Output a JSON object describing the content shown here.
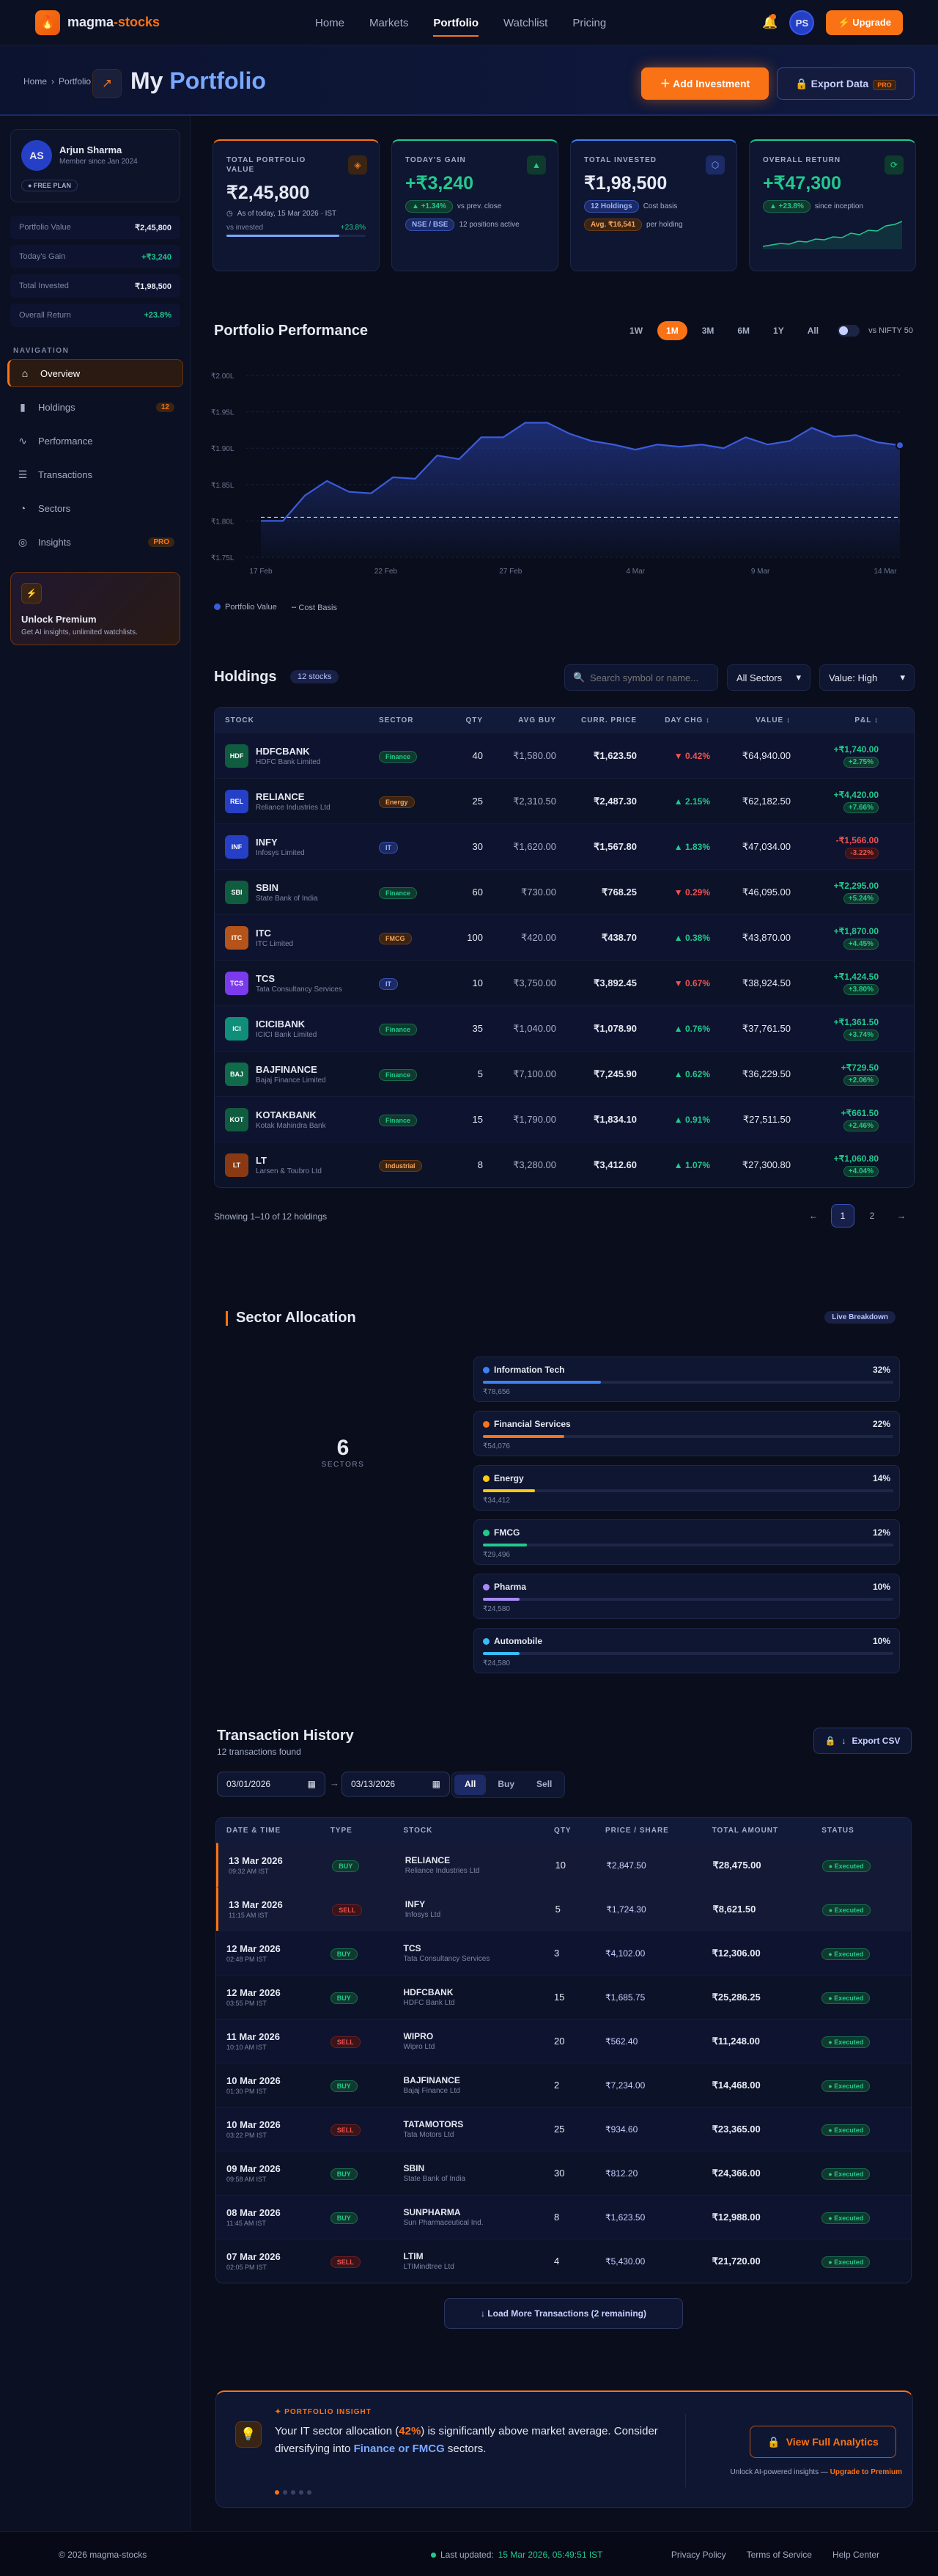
{
  "brand": {
    "name_a": "magma",
    "name_sep": "-",
    "name_b": "stocks"
  },
  "nav": {
    "links": [
      "Home",
      "Markets",
      "Portfolio",
      "Watchlist",
      "Pricing"
    ],
    "active": 2,
    "avatar": "PS",
    "upgrade": "Upgrade"
  },
  "header": {
    "crumb_home": "Home",
    "crumb_sep": "›",
    "crumb_current": "Portfolio",
    "title_a": "My",
    "title_b": "Portfolio",
    "add": "Add Investment",
    "export": "Export Data",
    "export_badge": "PRO"
  },
  "profile": {
    "initials": "AS",
    "name": "Arjun Sharma",
    "since": "Member since Jan 2024",
    "plan": "● FREE PLAN"
  },
  "side_stats": [
    {
      "label": "Portfolio Value",
      "value": "₹2,45,800",
      "tone": ""
    },
    {
      "label": "Today's Gain",
      "value": "+₹3,240",
      "tone": "green"
    },
    {
      "label": "Total Invested",
      "value": "₹1,98,500",
      "tone": ""
    },
    {
      "label": "Overall Return",
      "value": "+23.8%",
      "tone": "green"
    }
  ],
  "nav_label": "NAVIGATION",
  "side_nav": [
    {
      "label": "Overview",
      "icon": "home-icon",
      "badge": ""
    },
    {
      "label": "Holdings",
      "icon": "bar-chart-icon",
      "badge": "12"
    },
    {
      "label": "Performance",
      "icon": "pulse-icon",
      "badge": ""
    },
    {
      "label": "Transactions",
      "icon": "list-icon",
      "badge": ""
    },
    {
      "label": "Sectors",
      "icon": "pie-icon",
      "badge": ""
    },
    {
      "label": "Insights",
      "icon": "bulb-icon",
      "badge": "PRO"
    }
  ],
  "promo": {
    "title": "Unlock Premium",
    "desc": "Get AI insights, unlimited watchlists."
  },
  "kpis": [
    {
      "label": "TOTAL PORTFOLIO VALUE",
      "value": "₹2,45,800",
      "note": "As of today, 15 Mar 2026 · IST",
      "bar_label": "vs invested",
      "bar_value": "+23.8%",
      "bar_fill": 0.81,
      "accent": "#f97316"
    },
    {
      "label": "TODAY'S GAIN",
      "value": "+₹3,240",
      "pill": "▲ +1.34%",
      "note": "vs prev. close",
      "pill2": "NSE / BSE",
      "note2": "12 positions active",
      "accent": "#22c98e"
    },
    {
      "label": "TOTAL INVESTED",
      "value": "₹1,98,500",
      "pill": "12 Holdings",
      "note": "Cost basis",
      "pill2": "Avg. ₹16,541",
      "note2": "per holding",
      "accent": "#3b82f6"
    },
    {
      "label": "OVERALL RETURN",
      "value": "+₹47,300",
      "pill": "▲ +23.8%",
      "note": "since inception",
      "accent": "#22c98e"
    }
  ],
  "perf": {
    "title": "Portfolio Performance",
    "ranges": [
      "1W",
      "1M",
      "3M",
      "6M",
      "1Y",
      "All"
    ],
    "active_range": 1,
    "compare": "vs NIFTY 50",
    "legend_value": "Portfolio Value",
    "legend_cost": "Cost Basis"
  },
  "chart_data": {
    "type": "line",
    "y_ticks": [
      "₹2.00L",
      "₹1.95L",
      "₹1.90L",
      "₹1.85L",
      "₹1.80L",
      "₹1.75L"
    ],
    "x_ticks": [
      "17 Feb",
      "22 Feb",
      "27 Feb",
      "4 Mar",
      "9 Mar",
      "14 Mar"
    ],
    "ylim": [
      1.75,
      2.0
    ],
    "series": [
      {
        "name": "Portfolio Value",
        "values": [
          1.8,
          1.8,
          1.835,
          1.855,
          1.84,
          1.838,
          1.86,
          1.858,
          1.89,
          1.885,
          1.915,
          1.915,
          1.935,
          1.935,
          1.92,
          1.91,
          1.905,
          1.898,
          1.905,
          1.902,
          1.905,
          1.9,
          1.915,
          1.905,
          1.91,
          1.928,
          1.916,
          1.918,
          1.908,
          1.904
        ]
      },
      {
        "name": "Cost Basis",
        "values": [
          1.805,
          1.805,
          1.805,
          1.805,
          1.805,
          1.805,
          1.805,
          1.805,
          1.805,
          1.805,
          1.805,
          1.805,
          1.805,
          1.805,
          1.805,
          1.805,
          1.805,
          1.805,
          1.805,
          1.805,
          1.805,
          1.805,
          1.805,
          1.805,
          1.805,
          1.805,
          1.805,
          1.805,
          1.805,
          1.805
        ]
      }
    ],
    "grid": true,
    "legend": "bottom-left"
  },
  "holdings": {
    "title": "Holdings",
    "count": "12 stocks",
    "search_placeholder": "Search symbol or name...",
    "sector_filter": "All Sectors",
    "sort": "Value: High",
    "columns": [
      "STOCK",
      "SECTOR",
      "QTY",
      "AVG BUY",
      "CURR. PRICE",
      "DAY CHG ↕",
      "VALUE ↕",
      "P&L ↕"
    ],
    "rows": [
      {
        "tk": "HDF",
        "sym": "HDFCBANK",
        "name": "HDFC Bank Limited",
        "sector": "Finance",
        "qty": "40",
        "avg": "₹1,580.00",
        "cur": "₹1,623.50",
        "day": "▼ 0.42%",
        "day_up": false,
        "value": "₹64,940.00",
        "pl": "+₹1,740.00",
        "plp": "+2.75%",
        "pl_up": true,
        "color": "#0f5c3f"
      },
      {
        "tk": "REL",
        "sym": "RELIANCE",
        "name": "Reliance Industries Ltd",
        "sector": "Energy",
        "qty": "25",
        "avg": "₹2,310.50",
        "cur": "₹2,487.30",
        "day": "▲ 2.15%",
        "day_up": true,
        "value": "₹62,182.50",
        "pl": "+₹4,420.00",
        "plp": "+7.66%",
        "pl_up": true,
        "color": "#2540c7"
      },
      {
        "tk": "INF",
        "sym": "INFY",
        "name": "Infosys Limited",
        "sector": "IT",
        "qty": "30",
        "avg": "₹1,620.00",
        "cur": "₹1,567.80",
        "day": "▲ 1.83%",
        "day_up": true,
        "value": "₹47,034.00",
        "pl": "-₹1,566.00",
        "plp": "-3.22%",
        "pl_up": false,
        "color": "#2540c7"
      },
      {
        "tk": "SBI",
        "sym": "SBIN",
        "name": "State Bank of India",
        "sector": "Finance",
        "qty": "60",
        "avg": "₹730.00",
        "cur": "₹768.25",
        "day": "▼ 0.29%",
        "day_up": false,
        "value": "₹46,095.00",
        "pl": "+₹2,295.00",
        "plp": "+5.24%",
        "pl_up": true,
        "color": "#0f5c3f"
      },
      {
        "tk": "ITC",
        "sym": "ITC",
        "name": "ITC Limited",
        "sector": "FMCG",
        "qty": "100",
        "avg": "₹420.00",
        "cur": "₹438.70",
        "day": "▲ 0.38%",
        "day_up": true,
        "value": "₹43,870.00",
        "pl": "+₹1,870.00",
        "plp": "+4.45%",
        "pl_up": true,
        "color": "#b4531a"
      },
      {
        "tk": "TCS",
        "sym": "TCS",
        "name": "Tata Consultancy Services",
        "sector": "IT",
        "qty": "10",
        "avg": "₹3,750.00",
        "cur": "₹3,892.45",
        "day": "▼ 0.67%",
        "day_up": false,
        "value": "₹38,924.50",
        "pl": "+₹1,424.50",
        "plp": "+3.80%",
        "pl_up": true,
        "color": "#7c3aed"
      },
      {
        "tk": "ICI",
        "sym": "ICICIBANK",
        "name": "ICICI Bank Limited",
        "sector": "Finance",
        "qty": "35",
        "avg": "₹1,040.00",
        "cur": "₹1,078.90",
        "day": "▲ 0.76%",
        "day_up": true,
        "value": "₹37,761.50",
        "pl": "+₹1,361.50",
        "plp": "+3.74%",
        "pl_up": true,
        "color": "#0f8f7a"
      },
      {
        "tk": "BAJ",
        "sym": "BAJFINANCE",
        "name": "Bajaj Finance Limited",
        "sector": "Finance",
        "qty": "5",
        "avg": "₹7,100.00",
        "cur": "₹7,245.90",
        "day": "▲ 0.62%",
        "day_up": true,
        "value": "₹36,229.50",
        "pl": "+₹729.50",
        "plp": "+2.06%",
        "pl_up": true,
        "color": "#0f6b4a"
      },
      {
        "tk": "KOT",
        "sym": "KOTAKBANK",
        "name": "Kotak Mahindra Bank",
        "sector": "Finance",
        "qty": "15",
        "avg": "₹1,790.00",
        "cur": "₹1,834.10",
        "day": "▲ 0.91%",
        "day_up": true,
        "value": "₹27,511.50",
        "pl": "+₹661.50",
        "plp": "+2.46%",
        "pl_up": true,
        "color": "#0f5c3f"
      },
      {
        "tk": "LT",
        "sym": "LT",
        "name": "Larsen & Toubro Ltd",
        "sector": "Industrial",
        "qty": "8",
        "avg": "₹3,280.00",
        "cur": "₹3,412.60",
        "day": "▲ 1.07%",
        "day_up": true,
        "value": "₹27,300.80",
        "pl": "+₹1,060.80",
        "plp": "+4.04%",
        "pl_up": true,
        "color": "#8a3a12"
      }
    ],
    "showing": "Showing 1–10 of 12 holdings",
    "pages": [
      "←",
      "1",
      "2",
      "→"
    ]
  },
  "sectors": {
    "title": "Sector Allocation",
    "live": "Live Breakdown",
    "center_value": "6",
    "center_label": "SECTORS",
    "items": [
      {
        "name": "Information Tech",
        "pct": "32%",
        "frac": 0.32,
        "amt": "₹78,656",
        "color": "#3b82f6"
      },
      {
        "name": "Financial Services",
        "pct": "22%",
        "frac": 0.22,
        "amt": "₹54,076",
        "color": "#f97316"
      },
      {
        "name": "Energy",
        "pct": "14%",
        "frac": 0.14,
        "amt": "₹34,412",
        "color": "#facc15"
      },
      {
        "name": "FMCG",
        "pct": "12%",
        "frac": 0.12,
        "amt": "₹29,496",
        "color": "#22c98e"
      },
      {
        "name": "Pharma",
        "pct": "10%",
        "frac": 0.1,
        "amt": "₹24,580",
        "color": "#a78bfa"
      },
      {
        "name": "Automobile",
        "pct": "10%",
        "frac": 0.1,
        "amt": "₹24,580",
        "color": "#38bdf8"
      }
    ]
  },
  "tx": {
    "title": "Transaction History",
    "subtitle": "12 transactions found",
    "export": "Export CSV",
    "from": "03/01/2026",
    "to": "03/13/2026",
    "arrow": "→",
    "filters": [
      "All",
      "Buy",
      "Sell"
    ],
    "columns": [
      "DATE & TIME",
      "TYPE",
      "STOCK",
      "QTY",
      "PRICE / SHARE",
      "TOTAL AMOUNT",
      "STATUS"
    ],
    "rows": [
      {
        "date": "13 Mar 2026",
        "time": "09:32 AM IST",
        "type": "BUY",
        "sym": "RELIANCE",
        "name": "Reliance Industries Ltd",
        "qty": "10",
        "price": "₹2,847.50",
        "total": "₹28,475.00",
        "status": "● Executed",
        "hl": true
      },
      {
        "date": "13 Mar 2026",
        "time": "11:15 AM IST",
        "type": "SELL",
        "sym": "INFY",
        "name": "Infosys Ltd",
        "qty": "5",
        "price": "₹1,724.30",
        "total": "₹8,621.50",
        "status": "● Executed",
        "hl": true
      },
      {
        "date": "12 Mar 2026",
        "time": "02:48 PM IST",
        "type": "BUY",
        "sym": "TCS",
        "name": "Tata Consultancy Services",
        "qty": "3",
        "price": "₹4,102.00",
        "total": "₹12,306.00",
        "status": "● Executed",
        "hl": false
      },
      {
        "date": "12 Mar 2026",
        "time": "03:55 PM IST",
        "type": "BUY",
        "sym": "HDFCBANK",
        "name": "HDFC Bank Ltd",
        "qty": "15",
        "price": "₹1,685.75",
        "total": "₹25,286.25",
        "status": "● Executed",
        "hl": false
      },
      {
        "date": "11 Mar 2026",
        "time": "10:10 AM IST",
        "type": "SELL",
        "sym": "WIPRO",
        "name": "Wipro Ltd",
        "qty": "20",
        "price": "₹562.40",
        "total": "₹11,248.00",
        "status": "● Executed",
        "hl": false
      },
      {
        "date": "10 Mar 2026",
        "time": "01:30 PM IST",
        "type": "BUY",
        "sym": "BAJFINANCE",
        "name": "Bajaj Finance Ltd",
        "qty": "2",
        "price": "₹7,234.00",
        "total": "₹14,468.00",
        "status": "● Executed",
        "hl": false
      },
      {
        "date": "10 Mar 2026",
        "time": "03:22 PM IST",
        "type": "SELL",
        "sym": "TATAMOTORS",
        "name": "Tata Motors Ltd",
        "qty": "25",
        "price": "₹934.60",
        "total": "₹23,365.00",
        "status": "● Executed",
        "hl": false
      },
      {
        "date": "09 Mar 2026",
        "time": "09:58 AM IST",
        "type": "BUY",
        "sym": "SBIN",
        "name": "State Bank of India",
        "qty": "30",
        "price": "₹812.20",
        "total": "₹24,366.00",
        "status": "● Executed",
        "hl": false
      },
      {
        "date": "08 Mar 2026",
        "time": "11:45 AM IST",
        "type": "BUY",
        "sym": "SUNPHARMA",
        "name": "Sun Pharmaceutical Ind.",
        "qty": "8",
        "price": "₹1,623.50",
        "total": "₹12,988.00",
        "status": "● Executed",
        "hl": false
      },
      {
        "date": "07 Mar 2026",
        "time": "02:05 PM IST",
        "type": "SELL",
        "sym": "LTIM",
        "name": "LTIMindtree Ltd",
        "qty": "4",
        "price": "₹5,430.00",
        "total": "₹21,720.00",
        "status": "● Executed",
        "hl": false
      }
    ],
    "load_more": "↓ Load More Transactions (2 remaining)"
  },
  "insight": {
    "label": "✦ PORTFOLIO INSIGHT",
    "text_a": "Your IT sector allocation (",
    "pct": "42%",
    "text_b": ") is significantly above market average. Consider diversifying into ",
    "link1": "Finance or FMCG",
    "text_c": " sectors.",
    "cta": "View Full Analytics",
    "sub": "Unlock AI-powered insights —",
    "sub_link": "Upgrade to Premium"
  },
  "footer": {
    "copy": "© 2026 magma-stocks",
    "updated_label": "Last updated:",
    "updated": "15 Mar 2026, 05:49:51 IST",
    "links": [
      "Privacy Policy",
      "Terms of Service",
      "Help Center"
    ]
  }
}
